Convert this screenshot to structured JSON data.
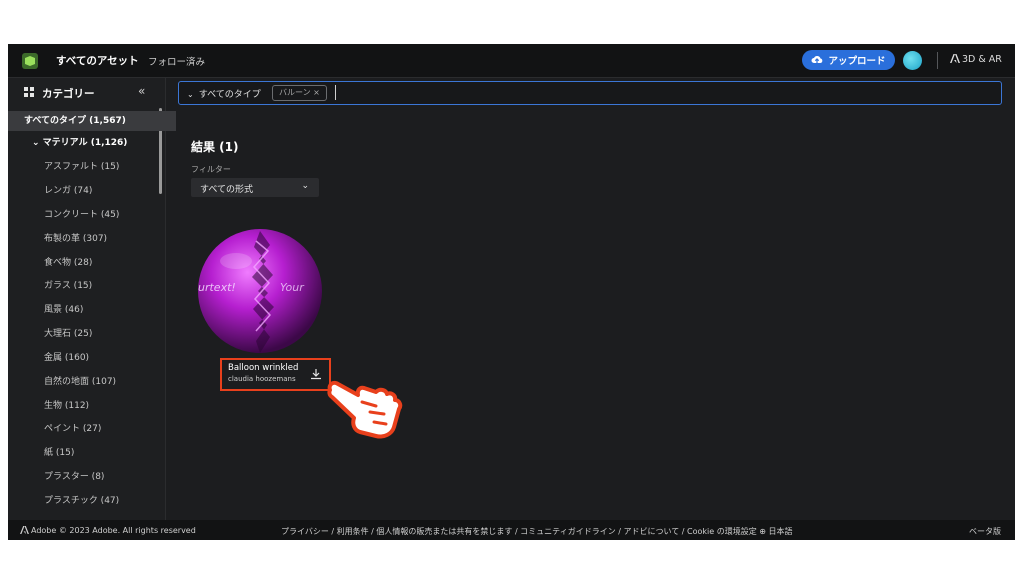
{
  "topbar": {
    "all_assets": "すべてのアセット",
    "following": "フォロー済み",
    "upload_label": "アップロード",
    "ar_link": "3D & AR"
  },
  "sidebar": {
    "title": "カテゴリー",
    "collapse_glyph": "«",
    "items": [
      {
        "label": "すべてのタイプ (1,567)"
      },
      {
        "label": "⌄ マテリアル (1,126)"
      },
      {
        "label": "アスファルト (15)"
      },
      {
        "label": "レンガ (74)"
      },
      {
        "label": "コンクリート (45)"
      },
      {
        "label": "布製の革 (307)"
      },
      {
        "label": "食べ物 (28)"
      },
      {
        "label": "ガラス (15)"
      },
      {
        "label": "風景 (46)"
      },
      {
        "label": "大理石 (25)"
      },
      {
        "label": "金属 (160)"
      },
      {
        "label": "自然の地面 (107)"
      },
      {
        "label": "生物 (112)"
      },
      {
        "label": "ペイント (27)"
      },
      {
        "label": "紙 (15)"
      },
      {
        "label": "プラスター (8)"
      },
      {
        "label": "プラスチック (47)"
      }
    ]
  },
  "filterbar": {
    "type_dropdown": "すべてのタイプ",
    "tag_label": "バルーン ×"
  },
  "results": {
    "title": "結果 (1)",
    "filter_label": "フィルター",
    "format_select": "すべての形式"
  },
  "card": {
    "name": "Balloon wrinkled",
    "author": "claudia hoozemans",
    "texture_text_left": "urtext!",
    "texture_text_right": "Your"
  },
  "footer": {
    "left": "Adobe © 2023 Adobe. All rights reserved",
    "links": "プライバシー / 利用条件 / 個人情報の販売または共有を禁じます / コミュニティガイドライン / アドビについて / Cookie の環境設定  ⊕ 日本語",
    "right": "ベータ版"
  },
  "colors": {
    "accent": "#2a6fdb",
    "highlight": "#e8401c",
    "balloon": "#b020c8"
  }
}
